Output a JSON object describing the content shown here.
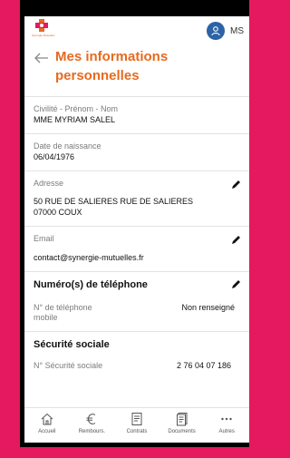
{
  "header": {
    "logo_text": "Synergie Mutuelles",
    "initials": "MS",
    "title": "Mes informations personnelles"
  },
  "fields": {
    "identity": {
      "label": "Civilité - Prénom - Nom",
      "value": "MME MYRIAM SALEL"
    },
    "birthdate": {
      "label": "Date de naissance",
      "value": "06/04/1976"
    },
    "address": {
      "label": "Adresse",
      "line1": "50 RUE DE SALIERES RUE DE SALIERES",
      "line2": "07000 COUX"
    },
    "email": {
      "label": "Email",
      "value": "contact@synergie-mutuelles.fr"
    }
  },
  "phone": {
    "heading": "Numéro(s) de téléphone",
    "label": "N° de téléphone mobile",
    "value": "Non renseigné"
  },
  "social_security": {
    "heading": "Sécurité sociale",
    "label": "N° Sécurité sociale",
    "value": "2 76 04 07 186"
  },
  "nav": [
    {
      "label": "Accueil",
      "icon": "home-icon"
    },
    {
      "label": "Rembours.",
      "icon": "euro-icon"
    },
    {
      "label": "Contrats",
      "icon": "contract-icon"
    },
    {
      "label": "Documents",
      "icon": "documents-icon"
    },
    {
      "label": "Autres",
      "icon": "more-icon"
    }
  ],
  "colors": {
    "accent": "#e66a1f",
    "background": "#e5195f",
    "avatar": "#2b63a6"
  }
}
